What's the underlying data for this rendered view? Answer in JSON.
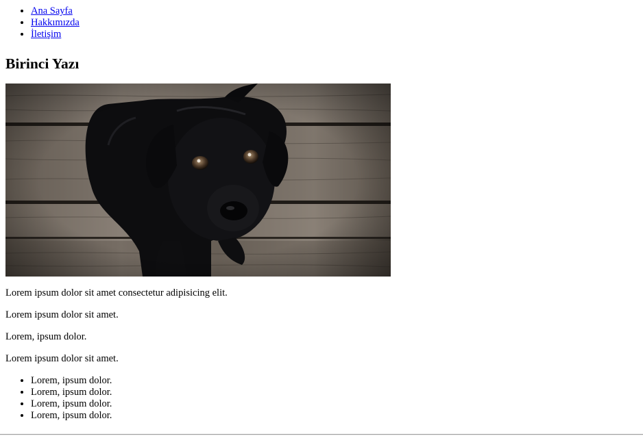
{
  "nav": {
    "items": [
      {
        "label": "Ana Sayfa"
      },
      {
        "label": "Hakkımızda"
      },
      {
        "label": "İletişim"
      }
    ],
    "link_color": "#0000ee"
  },
  "article": {
    "title": "Birinci Yazı",
    "image": {
      "icon": "dog-photo",
      "alt": ""
    },
    "paragraphs": [
      "Lorem ipsum dolor sit amet consectetur adipisicing elit.",
      "Lorem ipsum dolor sit amet.",
      "Lorem, ipsum dolor.",
      "Lorem ipsum dolor sit amet."
    ],
    "list": [
      "Lorem, ipsum dolor.",
      "Lorem, ipsum dolor.",
      "Lorem, ipsum dolor.",
      "Lorem, ipsum dolor."
    ]
  }
}
